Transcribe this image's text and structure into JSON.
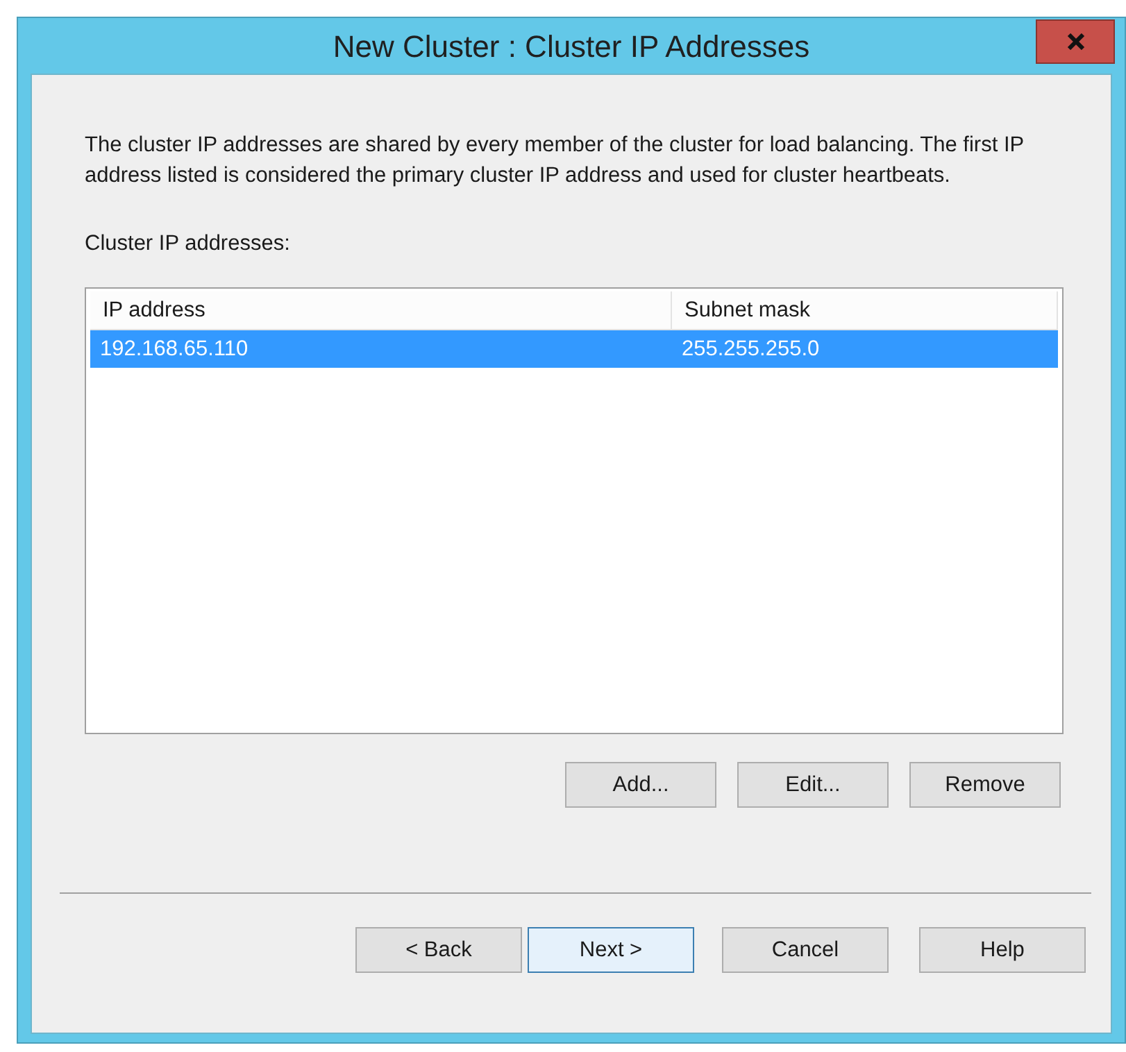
{
  "window": {
    "title": "New Cluster :  Cluster IP Addresses"
  },
  "description": "The cluster IP addresses are shared by every member of the cluster for load balancing. The first IP address listed is considered the primary cluster IP address and used for cluster heartbeats.",
  "list_label": "Cluster IP addresses:",
  "table": {
    "columns": [
      "IP address",
      "Subnet mask"
    ],
    "rows": [
      {
        "cells": [
          "192.168.65.110",
          "255.255.255.0"
        ],
        "selected": true
      }
    ]
  },
  "list_buttons": [
    "Add...",
    "Edit...",
    "Remove"
  ],
  "wizard_buttons": [
    {
      "label": "< Back",
      "default": false
    },
    {
      "label": "Next >",
      "default": true
    },
    {
      "label": "Cancel",
      "default": false
    },
    {
      "label": "Help",
      "default": false
    }
  ]
}
